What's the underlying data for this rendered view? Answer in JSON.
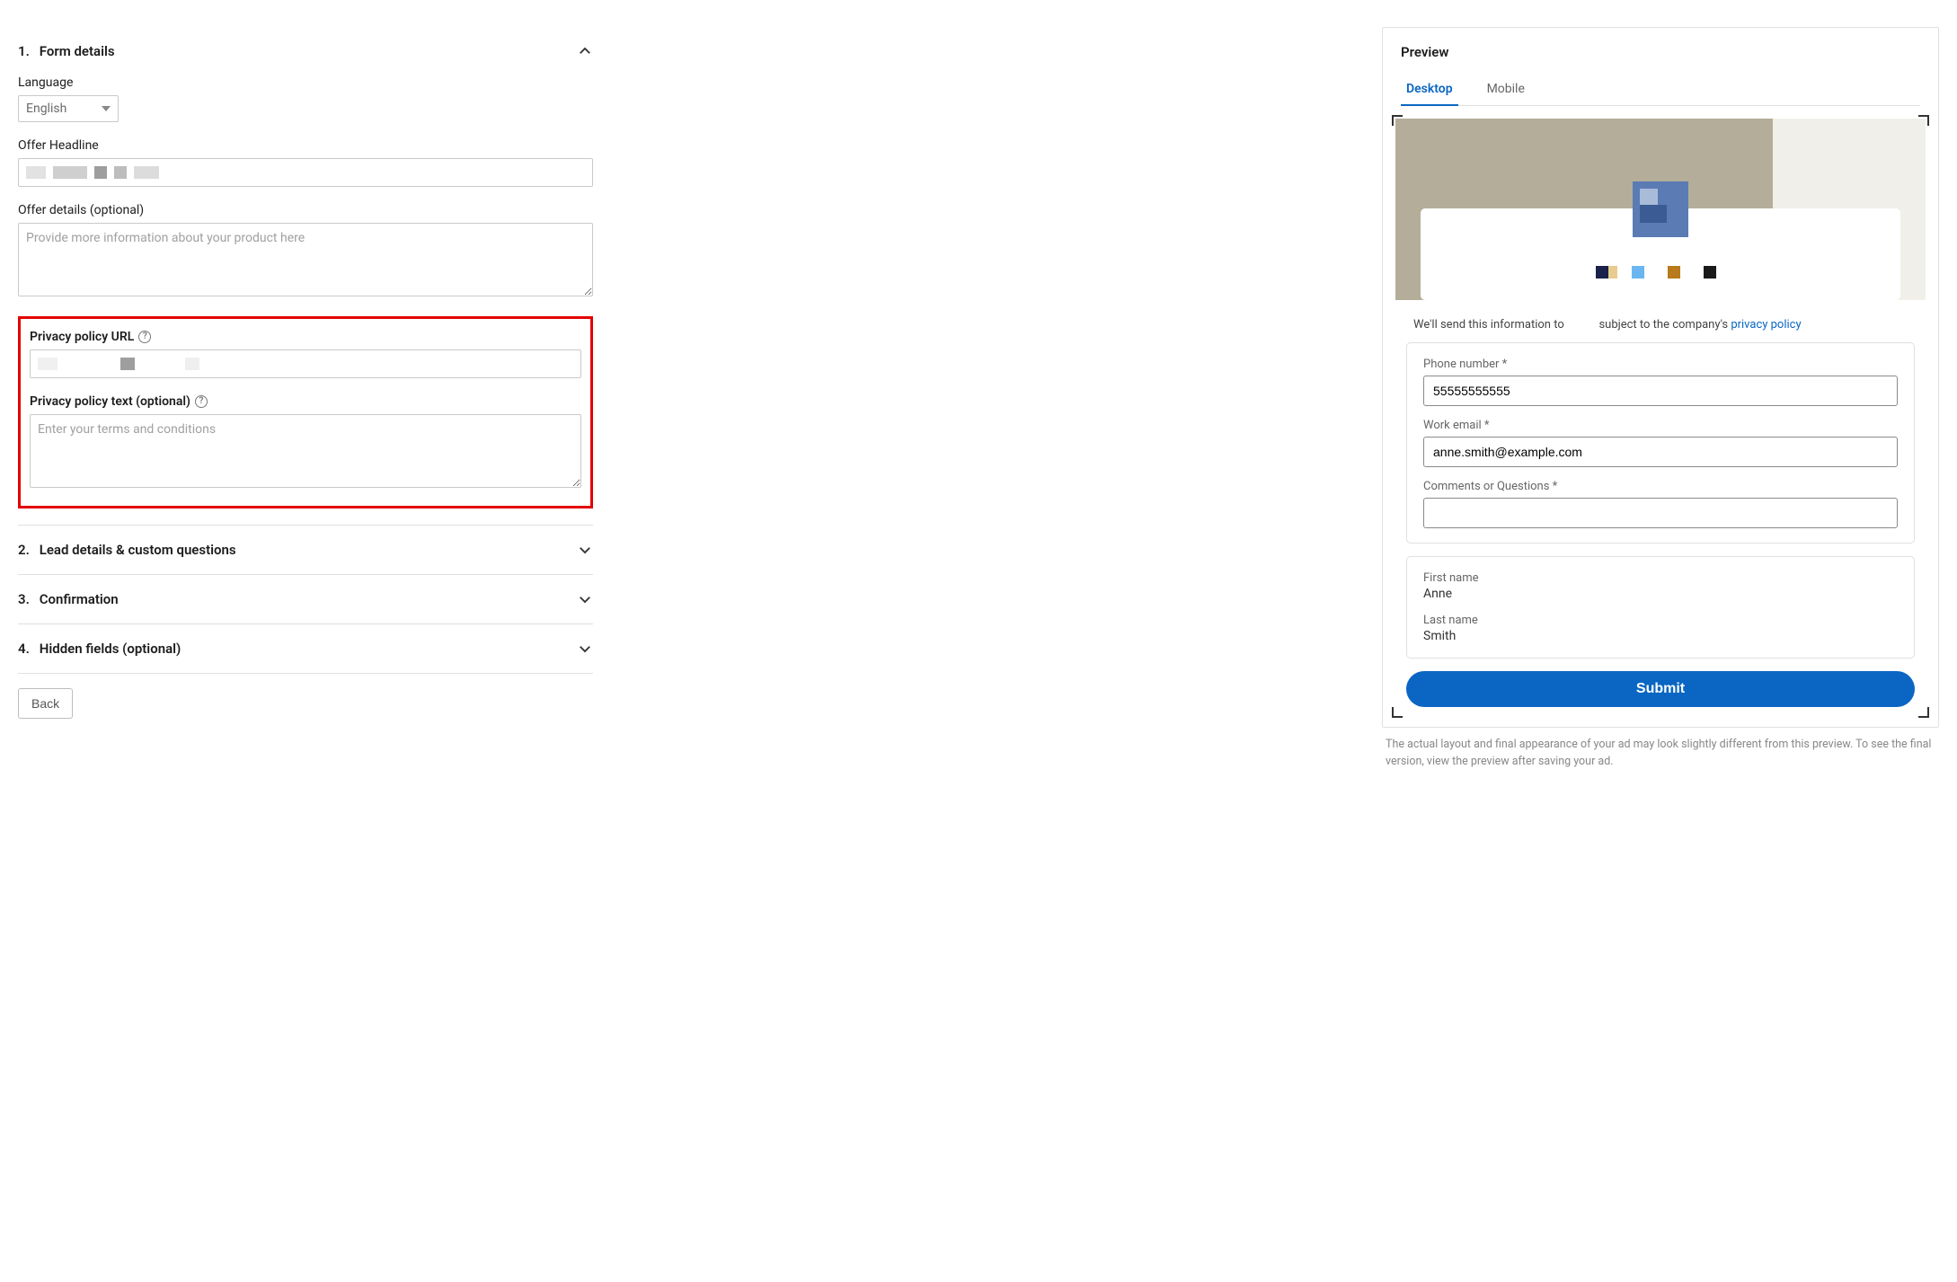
{
  "sections": {
    "s1": {
      "number": "1.",
      "title": "Form details"
    },
    "s2": {
      "number": "2.",
      "title": "Lead details & custom questions"
    },
    "s3": {
      "number": "3.",
      "title": "Confirmation"
    },
    "s4": {
      "number": "4.",
      "title": "Hidden fields (optional)"
    }
  },
  "form": {
    "language_label": "Language",
    "language_value": "English",
    "offer_headline_label": "Offer Headline",
    "offer_details_label": "Offer details (optional)",
    "offer_details_placeholder": "Provide more information about your product here",
    "privacy_url_label": "Privacy policy URL",
    "privacy_text_label": "Privacy policy text (optional)",
    "privacy_text_placeholder": "Enter your terms and conditions"
  },
  "back_label": "Back",
  "preview": {
    "title": "Preview",
    "tab_desktop": "Desktop",
    "tab_mobile": "Mobile",
    "info_prefix": "We'll send this information to",
    "info_mid": "subject to the company's ",
    "info_link": "privacy policy",
    "fields": {
      "phone_label": "Phone number *",
      "phone_value": "55555555555",
      "email_label": "Work email *",
      "email_value": "anne.smith@example.com",
      "comments_label": "Comments or Questions *",
      "comments_value": "",
      "firstname_label": "First name",
      "firstname_value": "Anne",
      "lastname_label": "Last name",
      "lastname_value": "Smith"
    },
    "submit_label": "Submit",
    "footnote": "The actual layout and final appearance of your ad may look slightly different from this preview. To see the final version, view the preview after saving your ad."
  }
}
